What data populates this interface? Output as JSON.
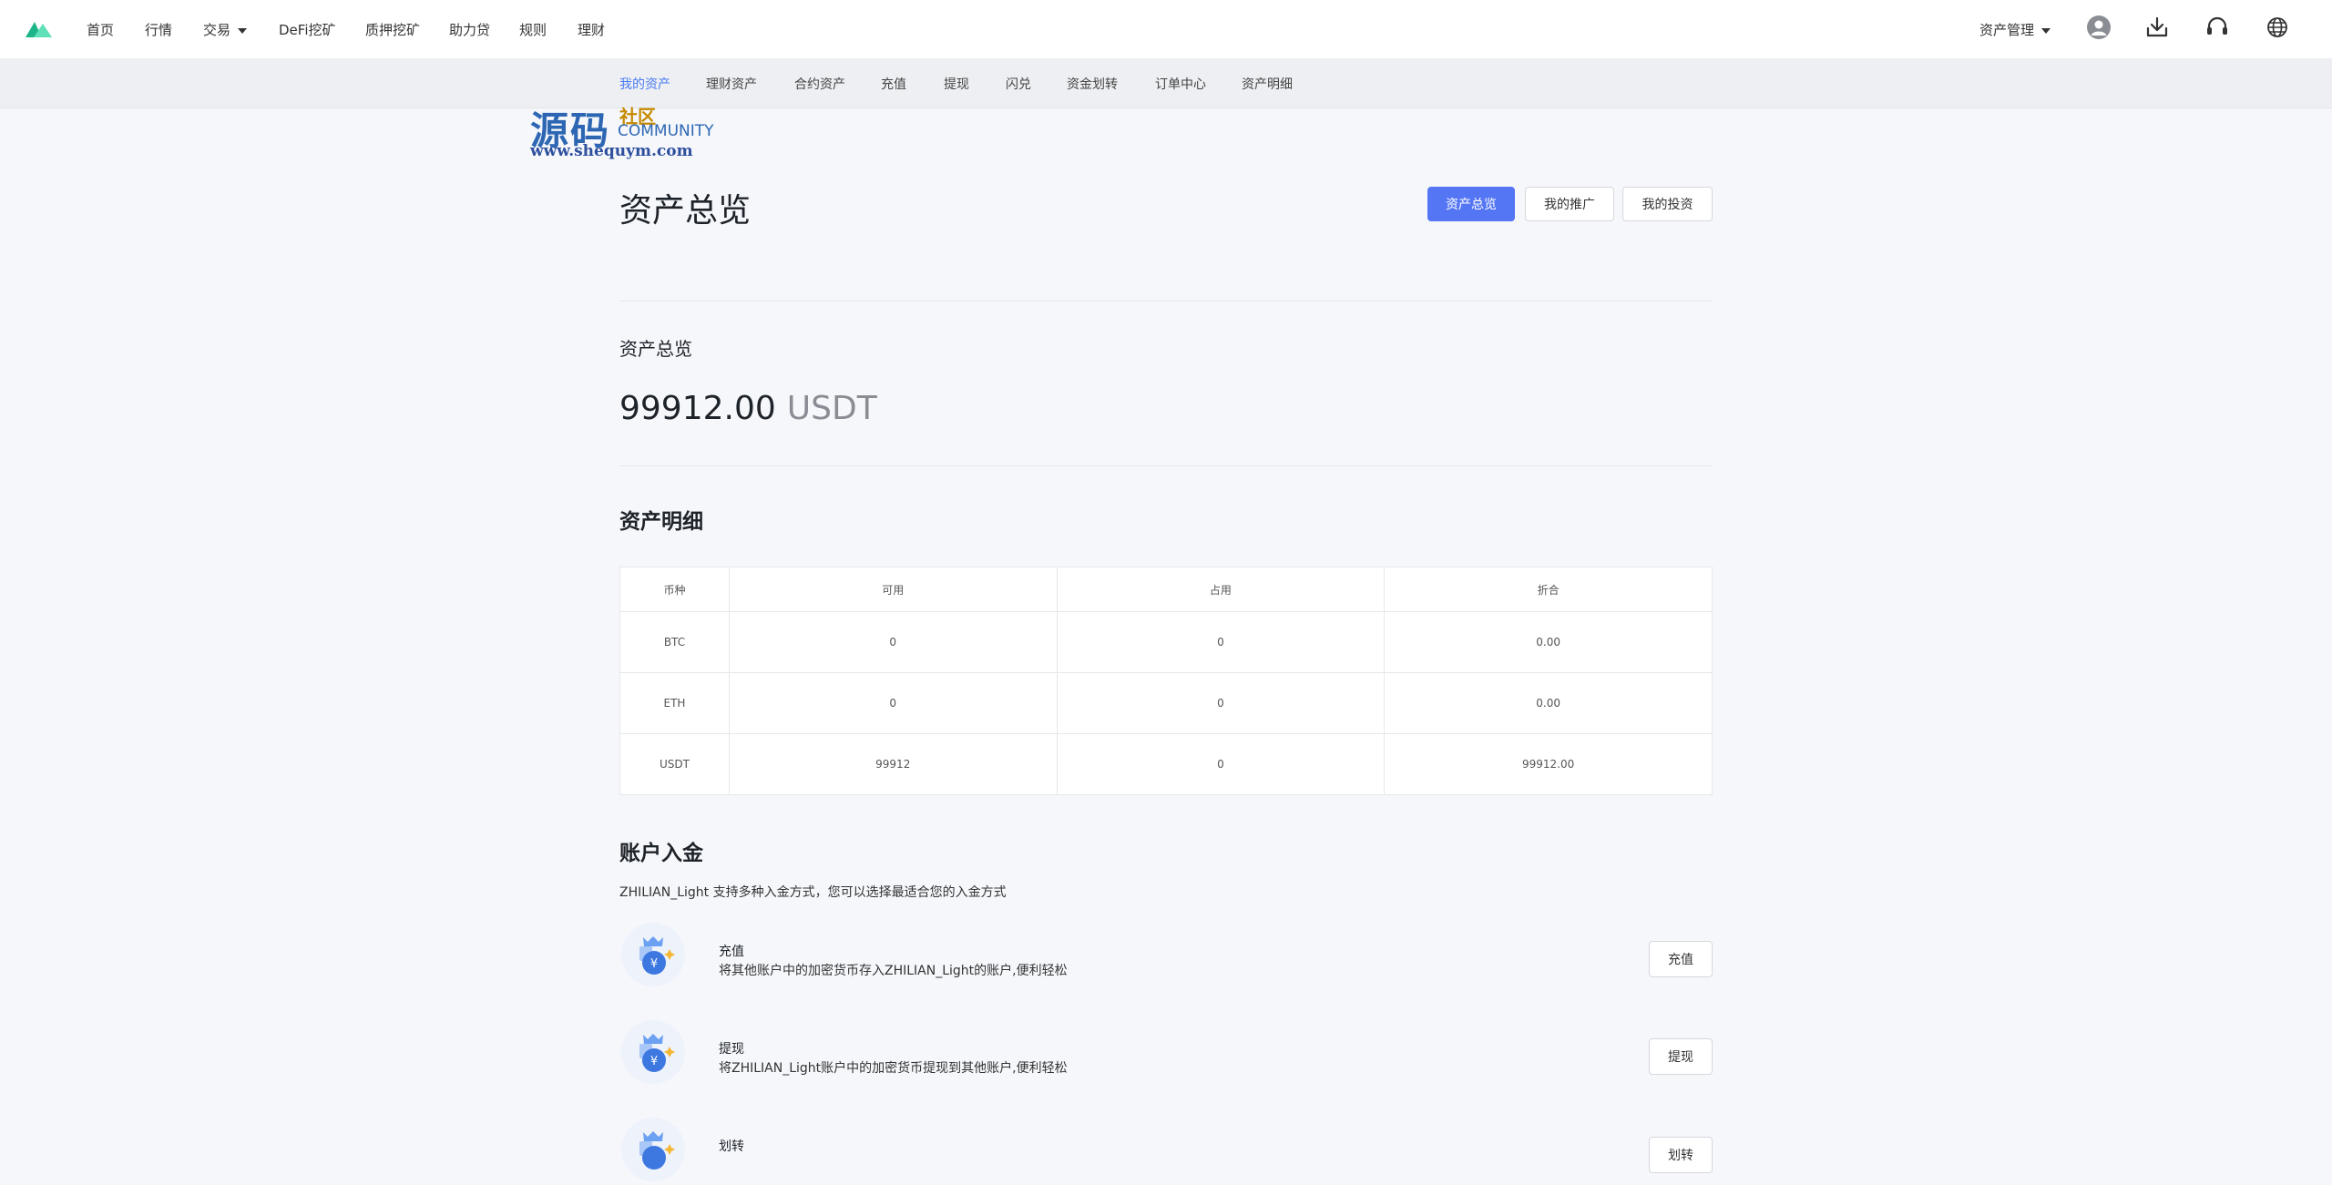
{
  "topnav": {
    "items": [
      "首页",
      "行情",
      "交易",
      "DeFi挖矿",
      "质押挖矿",
      "助力贷",
      "规则",
      "理财"
    ],
    "asset_menu": "资产管理"
  },
  "subnav": {
    "items": [
      "我的资产",
      "理财资产",
      "合约资产",
      "充值",
      "提现",
      "闪兑",
      "资金划转",
      "订单中心",
      "资产明细"
    ],
    "active": "我的资产"
  },
  "watermark": {
    "main": "源码",
    "sub": "社区",
    "community": "COMMUNITY",
    "url": "www.shequym.com"
  },
  "header": {
    "title": "资产总览",
    "buttons": [
      "资产总览",
      "我的推广",
      "我的投资"
    ]
  },
  "overview": {
    "label": "资产总览",
    "amount": "99912.00",
    "unit": "USDT"
  },
  "details": {
    "title": "资产明细",
    "columns": [
      "币种",
      "可用",
      "占用",
      "折合"
    ],
    "rows": [
      [
        "BTC",
        "0",
        "0",
        "0.00"
      ],
      [
        "ETH",
        "0",
        "0",
        "0.00"
      ],
      [
        "USDT",
        "99912",
        "0",
        "99912.00"
      ]
    ]
  },
  "deposit": {
    "title": "账户入金",
    "description": "ZHILIAN_Light 支持多种入金方式，您可以选择最适合您的入金方式",
    "methods": [
      {
        "title": "充值",
        "desc": "将其他账户中的加密货币存入ZHILIAN_Light的账户,便利轻松",
        "button": "充值"
      },
      {
        "title": "提现",
        "desc": "将ZHILIAN_Light账户中的加密货币提现到其他账户,便利轻松",
        "button": "提现"
      },
      {
        "title": "划转",
        "desc": "",
        "button": "划转"
      }
    ]
  },
  "colors": {
    "accent": "#5576f4",
    "active_tab": "#4a7cf5",
    "logo": "#2ec99b"
  },
  "icons": [
    "logo-icon",
    "user-icon",
    "download-icon",
    "headset-icon",
    "globe-icon",
    "money-bag-icon"
  ]
}
